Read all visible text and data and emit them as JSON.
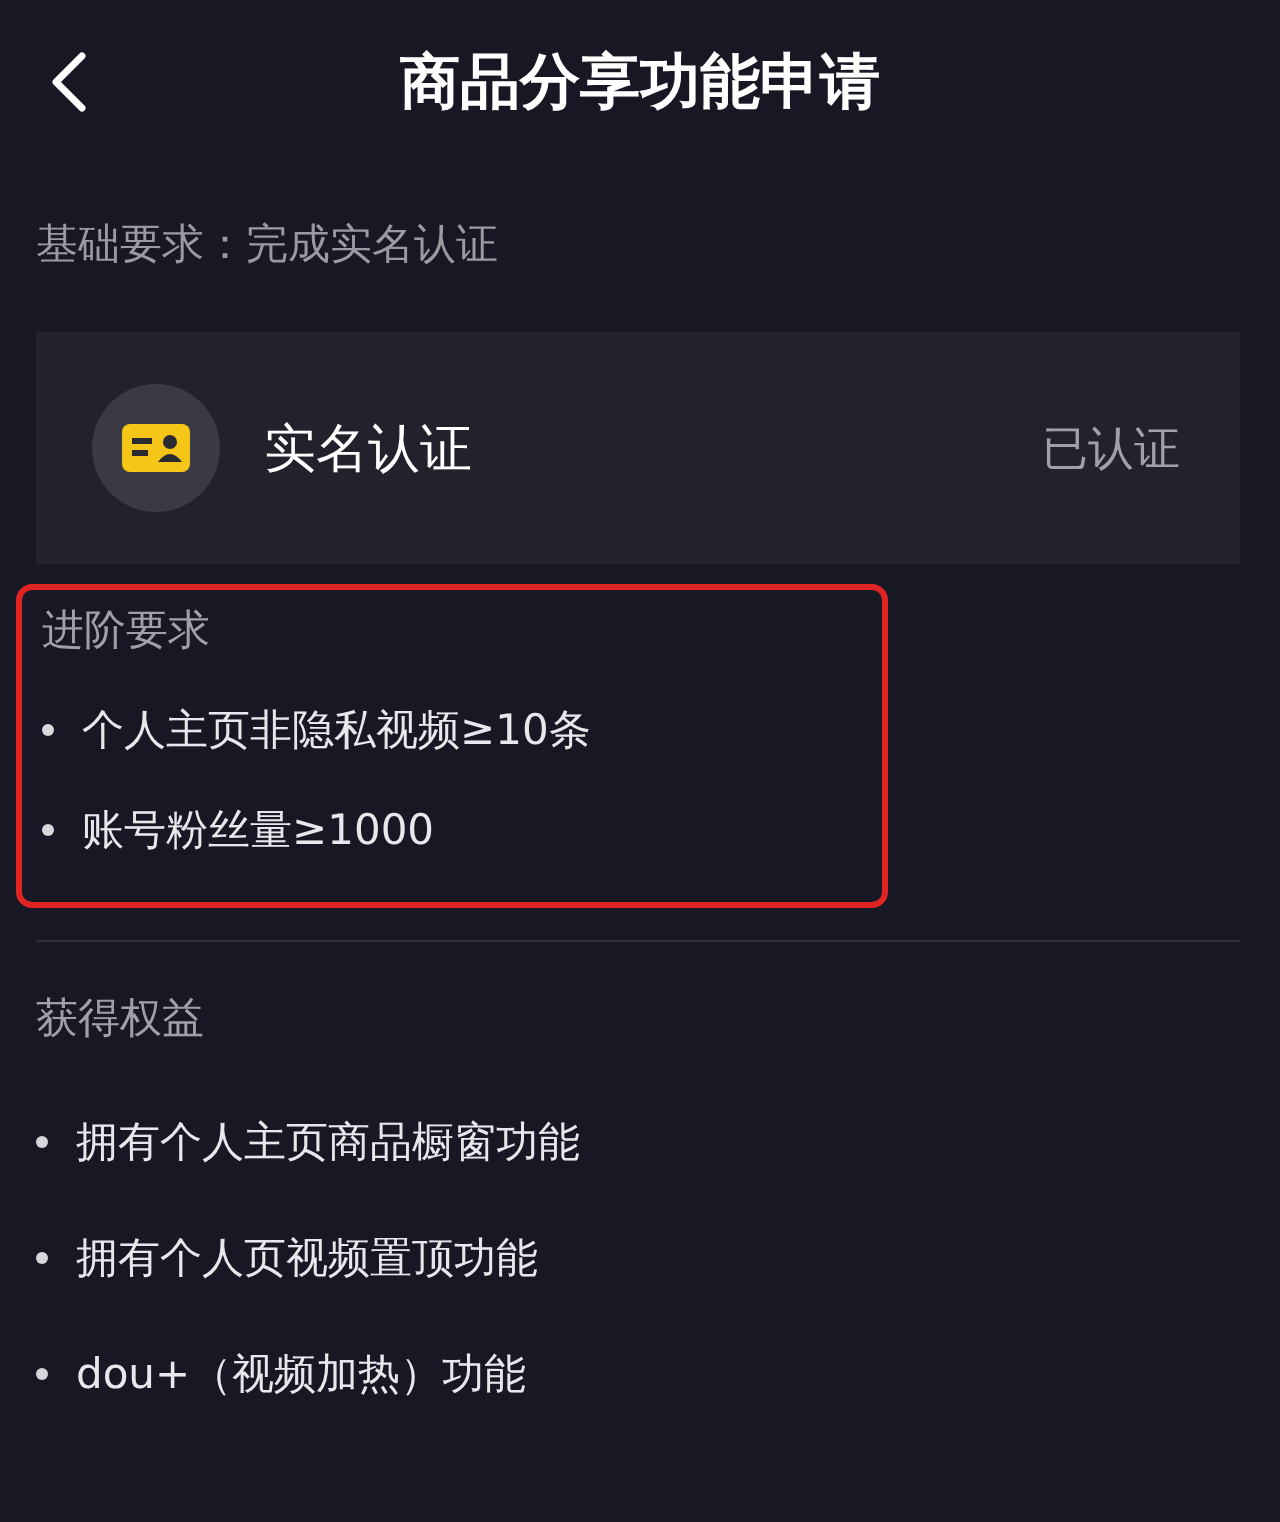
{
  "header": {
    "title": "商品分享功能申请"
  },
  "basic_requirement": "基础要求：完成实名认证",
  "verification": {
    "label": "实名认证",
    "status": "已认证"
  },
  "advanced": {
    "title": "进阶要求",
    "highlighted": true,
    "items": [
      "个人主页非隐私视频≥10条",
      "账号粉丝量≥1000"
    ]
  },
  "benefits": {
    "title": "获得权益",
    "items": [
      "拥有个人主页商品橱窗功能",
      "拥有个人页视频置顶功能",
      "dou+（视频加热）功能"
    ]
  }
}
